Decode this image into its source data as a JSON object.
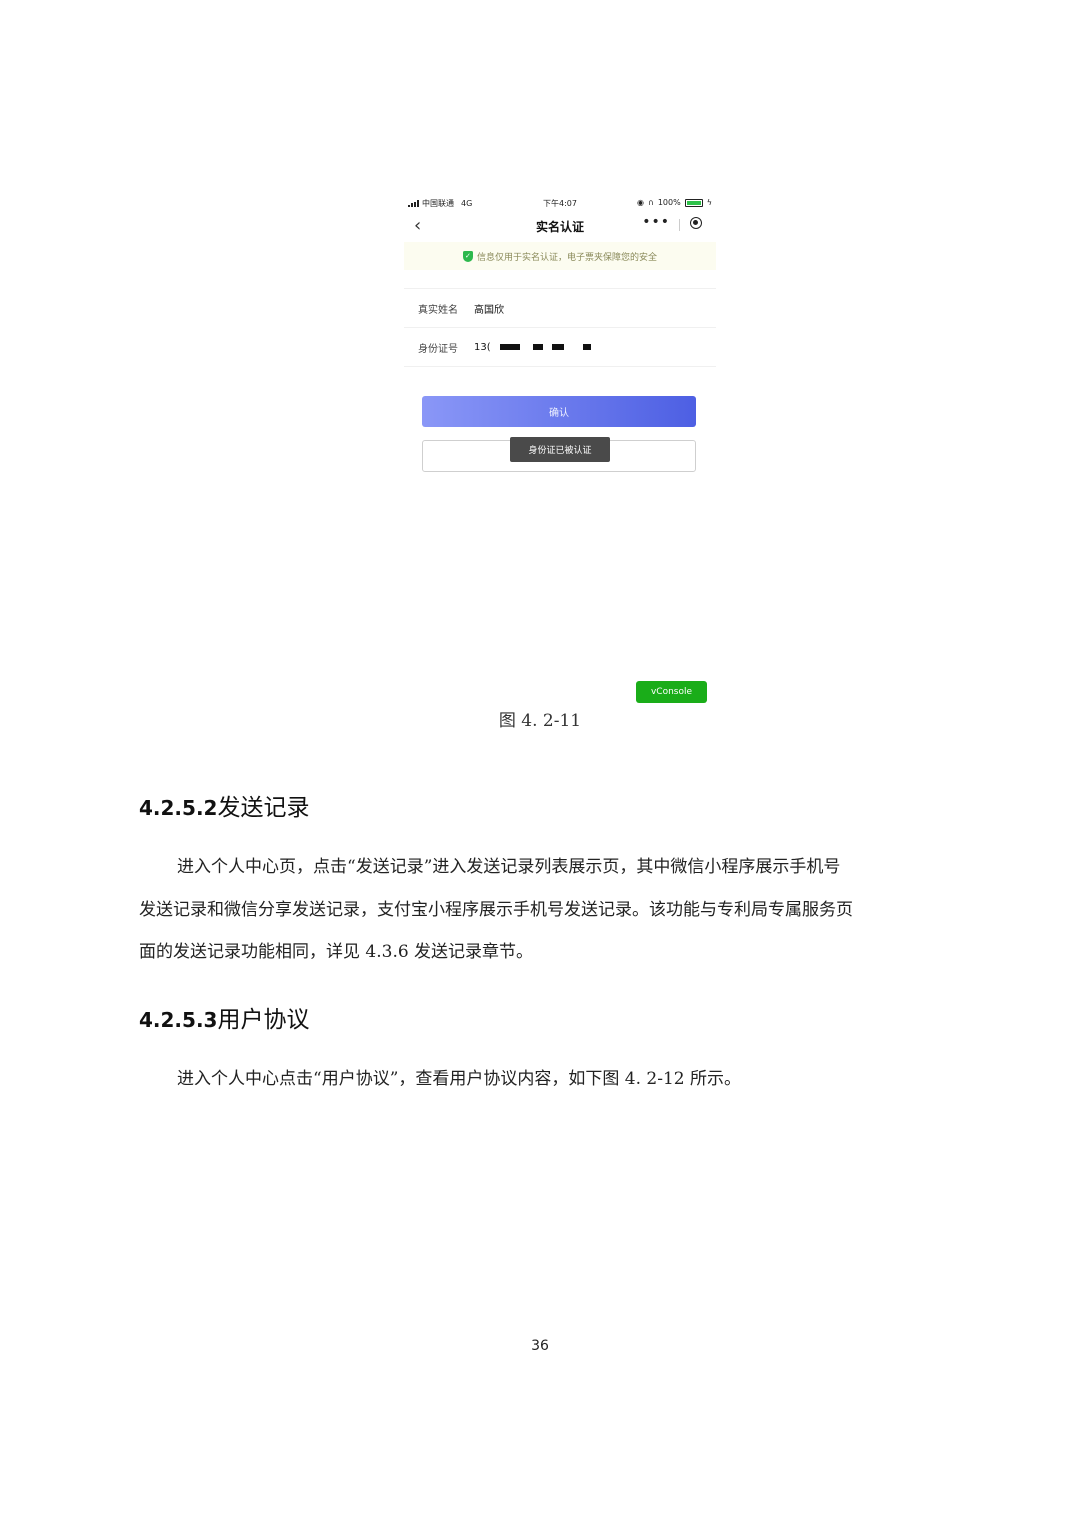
{
  "phone": {
    "status_bar": {
      "carrier": "中国联通",
      "network": "4G",
      "time": "下午4:07",
      "battery": "100%"
    },
    "nav": {
      "back_glyph": "‹",
      "title": "实名认证",
      "menu_glyph": "•••"
    },
    "notice": "信息仅用于实名认证，电子票夹保障您的安全",
    "form": {
      "name_label": "真实姓名",
      "name_value": "高国欣",
      "id_label": "身份证号",
      "id_value_visible": "13("
    },
    "confirm_label": "确认",
    "toast": "身份证已被认证",
    "vconsole_label": "vConsole",
    "colors": {
      "confirm_gradient_start": "#8a97f7",
      "confirm_gradient_end": "#4d5fe3",
      "vconsole": "#1aad19",
      "shield": "#2db84d"
    }
  },
  "figure_caption": "图 4. 2-11",
  "sections": [
    {
      "number": "4.2.5.2",
      "title": "发送记录",
      "lines": [
        "进入个人中心页，点击“发送记录”进入发送记录列表展示页，其中微信小程序展示手机号",
        "发送记录和微信分享发送记录，支付宝小程序展示手机号发送记录。该功能与专利局专属服务页",
        "面的发送记录功能相同，详见 4.3.6 发送记录章节。"
      ]
    },
    {
      "number": "4.2.5.3",
      "title": "用户协议",
      "lines": [
        "进入个人中心点击“用户协议”，查看用户协议内容，如下图 4. 2-12 所示。"
      ]
    }
  ],
  "page_number": "36"
}
